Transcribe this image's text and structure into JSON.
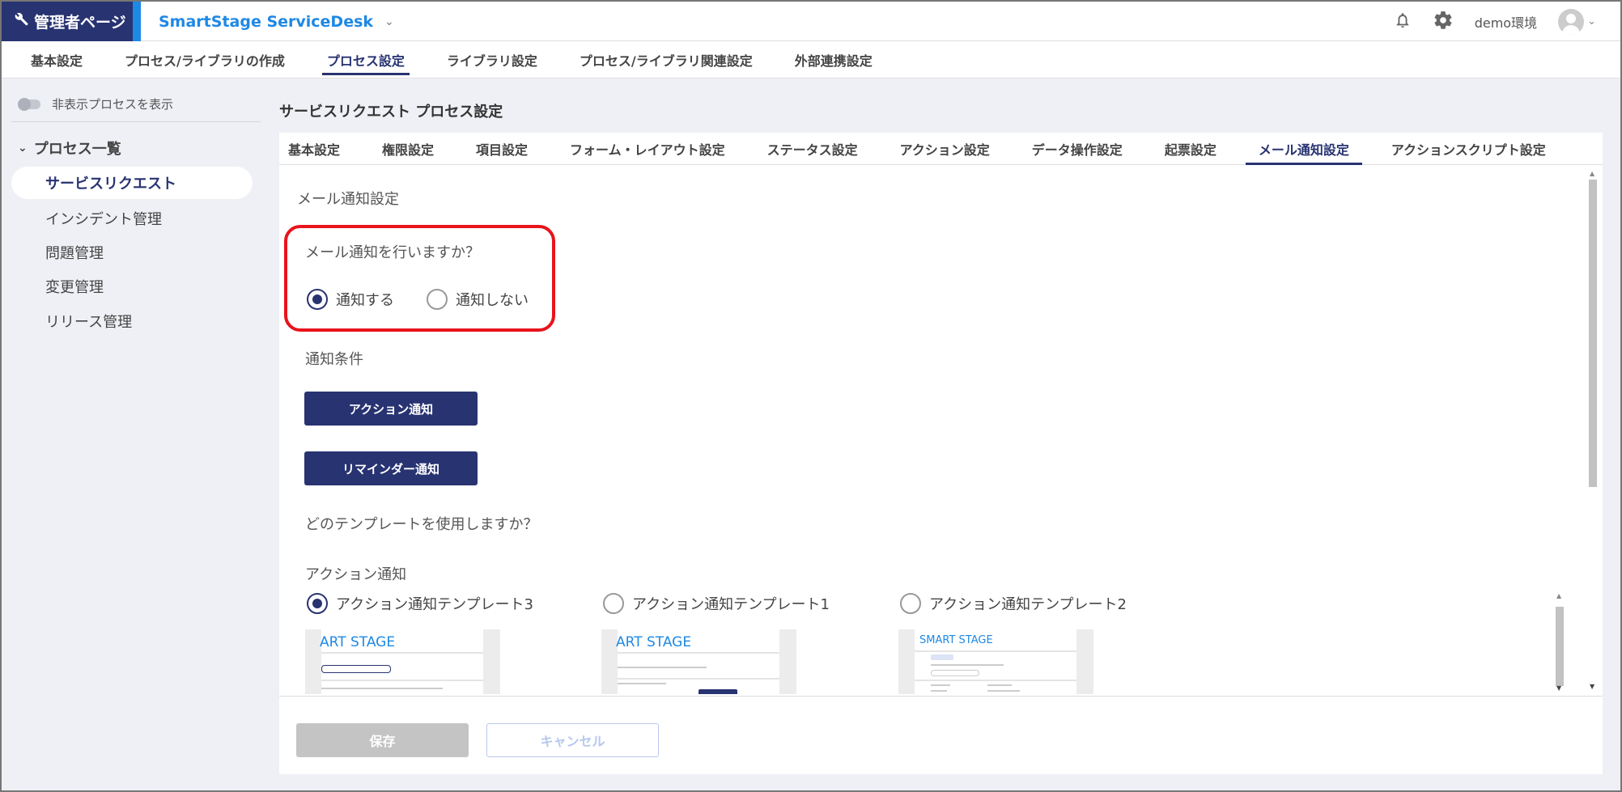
{
  "header": {
    "admin_label": "管理者ページ",
    "app_title": "SmartStage ServiceDesk",
    "environment": "demo環境"
  },
  "main_nav": [
    "基本設定",
    "プロセス/ライブラリの作成",
    "プロセス設定",
    "ライブラリ設定",
    "プロセス/ライブラリ関連設定",
    "外部連携設定"
  ],
  "main_nav_active": "プロセス設定",
  "sidebar": {
    "toggle_label": "非表示プロセスを表示",
    "group_title": "プロセス一覧",
    "items": [
      "サービスリクエスト",
      "インシデント管理",
      "問題管理",
      "変更管理",
      "リリース管理"
    ],
    "active": "サービスリクエスト"
  },
  "panel": {
    "title": "サービスリクエスト プロセス設定",
    "tabs": [
      "基本設定",
      "権限設定",
      "項目設定",
      "フォーム・レイアウト設定",
      "ステータス設定",
      "アクション設定",
      "データ操作設定",
      "起票設定",
      "メール通知設定",
      "アクションスクリプト設定"
    ],
    "active_tab": "メール通知設定"
  },
  "mail": {
    "section_title": "メール通知設定",
    "question": "メール通知を行いますか？",
    "option_yes": "通知する",
    "option_no": "通知しない",
    "selected": "通知する",
    "conditions_label": "通知条件",
    "action_button": "アクション通知",
    "reminder_button": "リマインダー通知",
    "template_question": "どのテンプレートを使用しますか？",
    "action_notice_label": "アクション通知",
    "templates": [
      "アクション通知テンプレート3",
      "アクション通知テンプレート1",
      "アクション通知テンプレート2"
    ],
    "selected_template": "アクション通知テンプレート3",
    "preview_logos": [
      "ART STAGE",
      "ART STAGE",
      "SMART STAGE"
    ]
  },
  "footer": {
    "save": "保存",
    "cancel": "キャンセル"
  },
  "colors": {
    "primary": "#283371",
    "accent": "#1e88e5",
    "highlight": "#e8141c",
    "sidebar_bg": "#eef0f5"
  }
}
